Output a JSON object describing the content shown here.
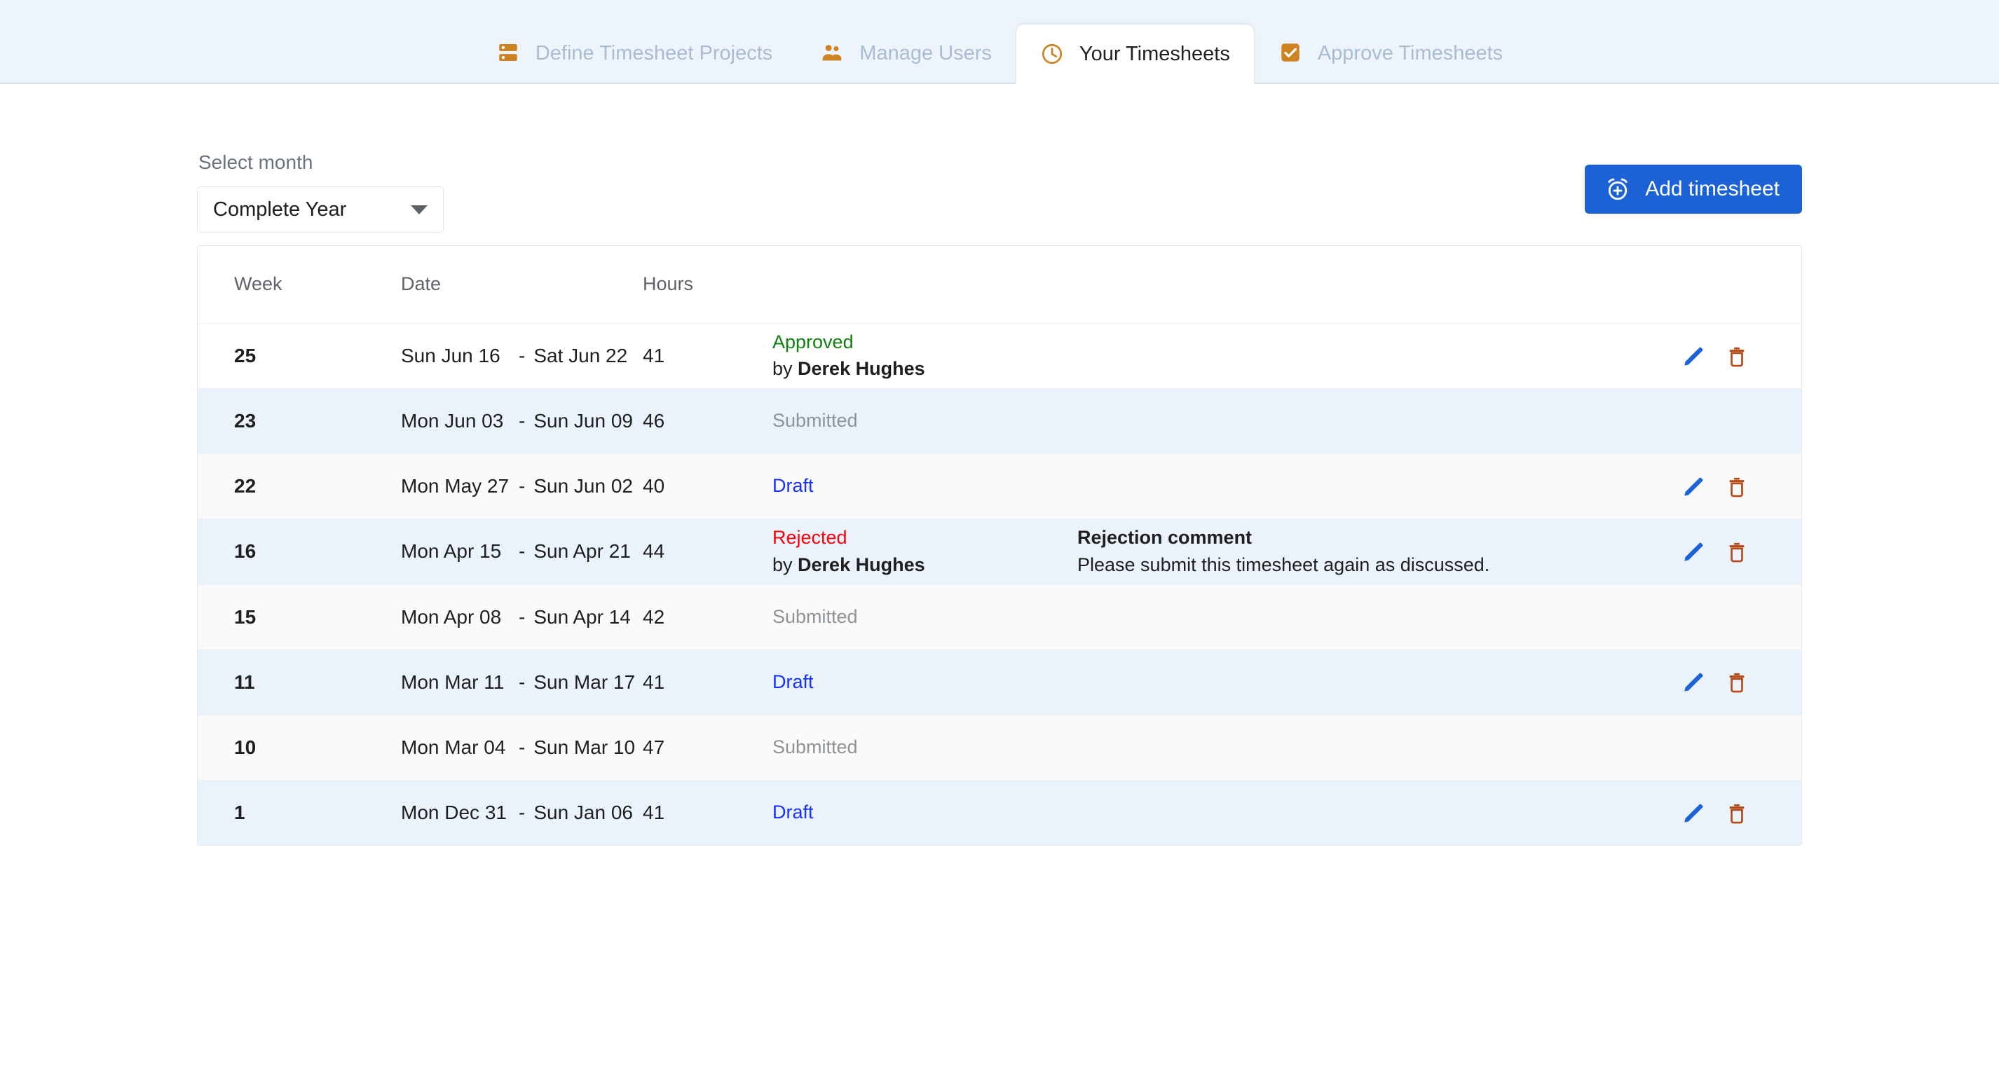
{
  "tabs": [
    {
      "label": "Define Timesheet Projects",
      "icon": "database-icon",
      "active": false
    },
    {
      "label": "Manage Users",
      "icon": "people-icon",
      "active": false
    },
    {
      "label": "Your Timesheets",
      "icon": "clock-icon",
      "active": true
    },
    {
      "label": "Approve Timesheets",
      "icon": "checkbox-checked-icon",
      "active": false
    }
  ],
  "toolbar": {
    "month_label": "Select month",
    "month_value": "Complete Year",
    "add_button": "Add timesheet"
  },
  "table": {
    "headers": [
      "Week",
      "Date",
      "Hours",
      "",
      "",
      ""
    ],
    "rows": [
      {
        "week": "25",
        "start": "Sun Jun 16",
        "dash": "-",
        "end": "Sat Jun 22",
        "hours": "41",
        "status": "Approved",
        "status_kind": "approved",
        "by": "by ",
        "by_name": "Derek Hughes",
        "comment_title": "",
        "comment_body": "",
        "actions": true
      },
      {
        "week": "23",
        "start": "Mon Jun 03",
        "dash": "-",
        "end": "Sun Jun 09",
        "hours": "46",
        "status": "Submitted",
        "status_kind": "submitted",
        "by": "",
        "by_name": "",
        "comment_title": "",
        "comment_body": "",
        "actions": false
      },
      {
        "week": "22",
        "start": "Mon May 27",
        "dash": "-",
        "end": "Sun Jun 02",
        "hours": "40",
        "status": "Draft",
        "status_kind": "draft",
        "by": "",
        "by_name": "",
        "comment_title": "",
        "comment_body": "",
        "actions": true
      },
      {
        "week": "16",
        "start": "Mon Apr 15",
        "dash": "-",
        "end": "Sun Apr 21",
        "hours": "44",
        "status": "Rejected",
        "status_kind": "rejected",
        "by": "by ",
        "by_name": "Derek Hughes",
        "comment_title": "Rejection comment",
        "comment_body": "Please submit this timesheet again as discussed.",
        "actions": true
      },
      {
        "week": "15",
        "start": "Mon Apr 08",
        "dash": "-",
        "end": "Sun Apr 14",
        "hours": "42",
        "status": "Submitted",
        "status_kind": "submitted",
        "by": "",
        "by_name": "",
        "comment_title": "",
        "comment_body": "",
        "actions": false
      },
      {
        "week": "11",
        "start": "Mon Mar 11",
        "dash": "-",
        "end": "Sun Mar 17",
        "hours": "41",
        "status": "Draft",
        "status_kind": "draft",
        "by": "",
        "by_name": "",
        "comment_title": "",
        "comment_body": "",
        "actions": true
      },
      {
        "week": "10",
        "start": "Mon Mar 04",
        "dash": "-",
        "end": "Sun Mar 10",
        "hours": "47",
        "status": "Submitted",
        "status_kind": "submitted",
        "by": "",
        "by_name": "",
        "comment_title": "",
        "comment_body": "",
        "actions": false
      },
      {
        "week": "1",
        "start": "Mon Dec 31",
        "dash": "-",
        "end": "Sun Jan 06",
        "hours": "41",
        "status": "Draft",
        "status_kind": "draft",
        "by": "",
        "by_name": "",
        "comment_title": "",
        "comment_body": "",
        "actions": true
      }
    ],
    "action_icons": {
      "edit": "pencil-icon",
      "delete": "trash-icon"
    }
  },
  "colors": {
    "tabbar_bg": "#eef4fc",
    "accent_orange": "#cf8220",
    "primary_blue": "#1a62d6",
    "approved_green": "#11800f",
    "rejected_red": "#fb0007",
    "draft_blue": "#1731ff",
    "submitted_gray": "#8e9398",
    "row_alt_blue": "#eaf2fb"
  }
}
